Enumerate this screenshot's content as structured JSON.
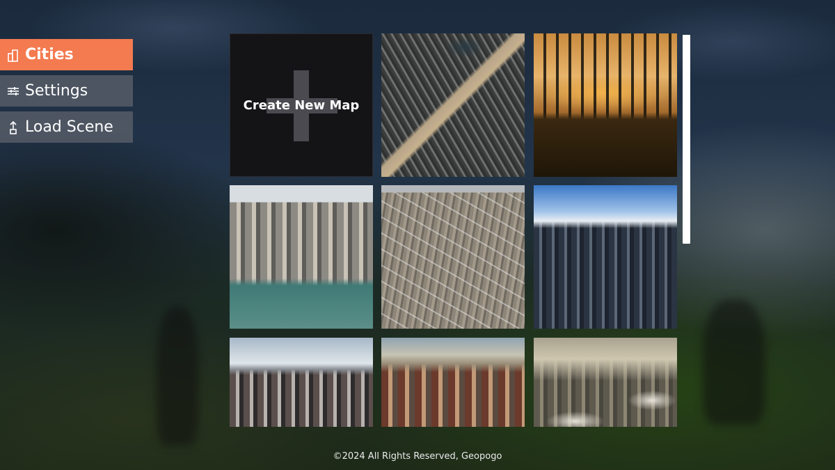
{
  "menu": {
    "items": [
      {
        "label": "Cities",
        "icon": "cities-icon",
        "active": true
      },
      {
        "label": "Settings",
        "icon": "sliders-icon",
        "active": false
      },
      {
        "label": "Load Scene",
        "icon": "upload-icon",
        "active": false
      }
    ]
  },
  "grid": {
    "create_label": "Create New Map",
    "tiles": [
      {
        "icon": "create-new-map-plus-icon"
      },
      {
        "icon": "city-aerial-thumbnail"
      },
      {
        "icon": "city-sunset-skyline-thumbnail"
      },
      {
        "icon": "city-waterfront-thumbnail"
      },
      {
        "icon": "city-grid-desert-thumbnail"
      },
      {
        "icon": "city-tall-towers-thumbnail"
      },
      {
        "icon": "city-mountain-skyline-thumbnail"
      },
      {
        "icon": "city-desert-towers-thumbnail"
      },
      {
        "icon": "city-hazy-skyline-thumbnail"
      }
    ]
  },
  "colors": {
    "accent": "#f47a4f",
    "menu_bg": "#5f646e",
    "create_tile_bg": "#141316",
    "scrollbar": "#ffffff"
  },
  "footer": {
    "text": "©2024 All Rights Reserved, Geopogo"
  }
}
